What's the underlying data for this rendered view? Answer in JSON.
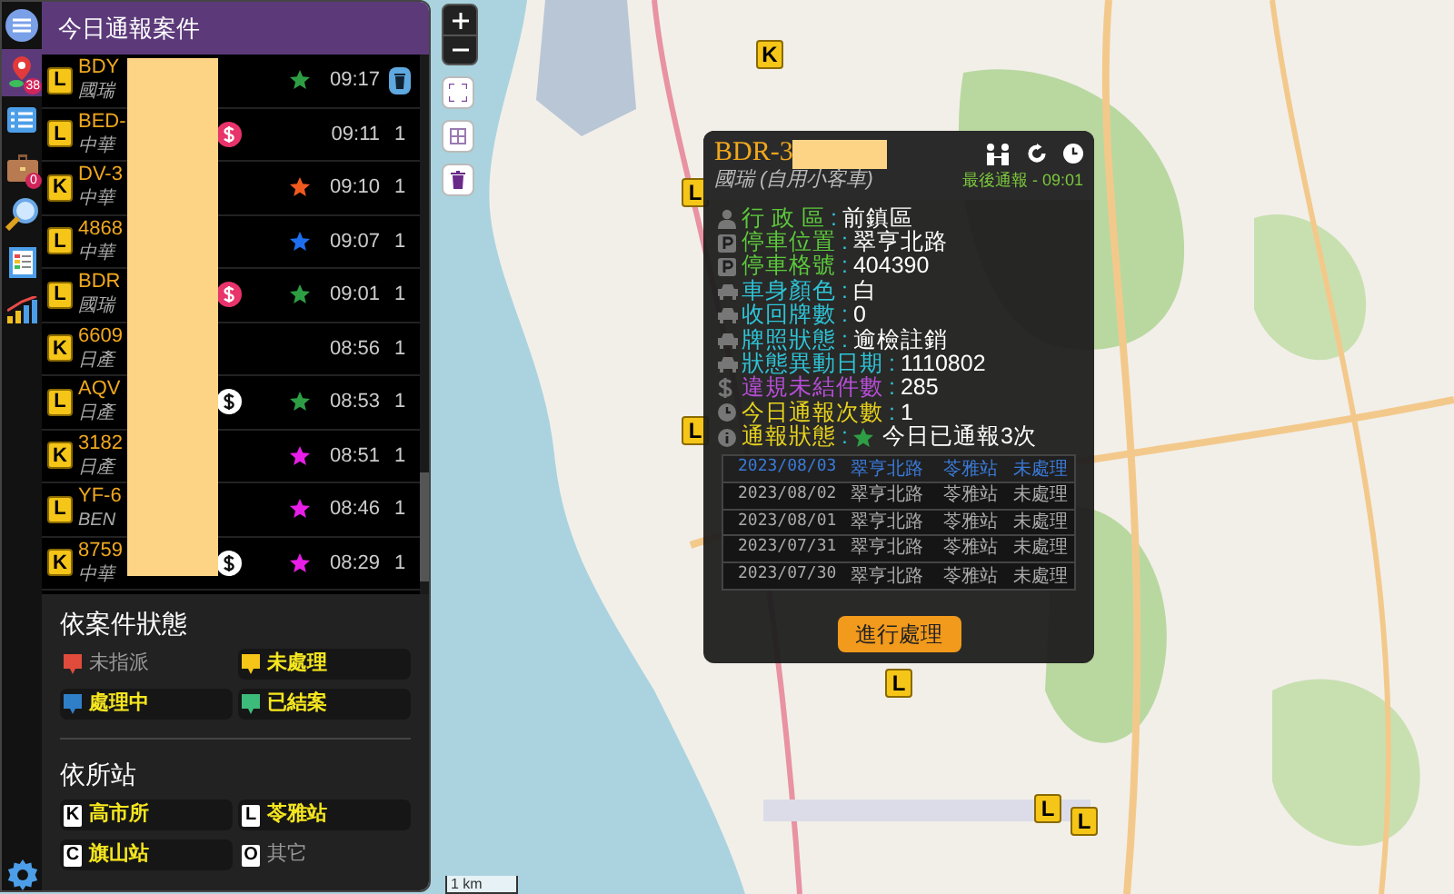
{
  "sidebar": {
    "title": "今日通報案件",
    "nav": [
      {
        "kind": "menu",
        "selected": false
      },
      {
        "kind": "pin",
        "selected": true,
        "badge": "38"
      },
      {
        "kind": "list",
        "selected": false
      },
      {
        "kind": "briefcase",
        "selected": false,
        "badge": "0"
      },
      {
        "kind": "search",
        "selected": false
      },
      {
        "kind": "report",
        "selected": false
      },
      {
        "kind": "chart",
        "selected": false
      }
    ],
    "cases": [
      {
        "station": "L",
        "plate": "BDY",
        "brand": "國瑞",
        "star": {
          "color": "#2e9e44"
        },
        "time": "09:17"
      },
      {
        "station": "L",
        "plate": "BED-",
        "brand": "中華",
        "dollar": {
          "color": "#e8336b"
        },
        "time": "09:11",
        "count": "1"
      },
      {
        "station": "K",
        "plate": "DV-3",
        "brand": "中華",
        "star": {
          "color": "#f05a1e"
        },
        "time": "09:10",
        "count": "1"
      },
      {
        "station": "L",
        "plate": "4868",
        "brand": "中華",
        "star": {
          "color": "#1e6ef0"
        },
        "time": "09:07",
        "count": "1"
      },
      {
        "station": "L",
        "plate": "BDR",
        "brand": "國瑞",
        "dollar": {
          "color": "#e8336b"
        },
        "star": {
          "color": "#2e9e44"
        },
        "time": "09:01",
        "count": "1"
      },
      {
        "station": "K",
        "plate": "6609",
        "brand": "日產",
        "time": "08:56",
        "count": "1"
      },
      {
        "station": "L",
        "plate": "AQV",
        "brand": "日產",
        "dollar": {
          "color": "#ffffff"
        },
        "star": {
          "color": "#2e9e44"
        },
        "time": "08:53",
        "count": "1"
      },
      {
        "station": "K",
        "plate": "3182",
        "brand": "日產",
        "star": {
          "color": "#e81ee8"
        },
        "time": "08:51",
        "count": "1"
      },
      {
        "station": "L",
        "plate": "YF-6",
        "brand": "BEN",
        "star": {
          "color": "#e81ee8"
        },
        "time": "08:46",
        "count": "1"
      },
      {
        "station": "K",
        "plate": "8759",
        "brand": "中華",
        "dollar": {
          "color": "#ffffff"
        },
        "star": {
          "color": "#e81ee8"
        },
        "time": "08:29",
        "count": "1"
      }
    ],
    "status_title": "依案件狀態",
    "statuses": [
      {
        "label": "未指派",
        "color": "#e04b3c",
        "selected": false
      },
      {
        "label": "未處理",
        "color": "#f5c518",
        "selected": true
      },
      {
        "label": "處理中",
        "color": "#2f7fc8",
        "selected": true
      },
      {
        "label": "已結案",
        "color": "#3dbb7a",
        "selected": true
      }
    ],
    "station_title": "依所站",
    "stations": [
      {
        "letter": "K",
        "label": "高市所",
        "selected": true
      },
      {
        "letter": "L",
        "label": "苓雅站",
        "selected": true
      },
      {
        "letter": "C",
        "label": "旗山站",
        "selected": true
      },
      {
        "letter": "O",
        "label": "其它",
        "selected": false
      }
    ]
  },
  "map": {
    "markers": [
      {
        "letter": "K"
      },
      {
        "letter": "L"
      },
      {
        "letter": "L"
      },
      {
        "letter": "L"
      },
      {
        "letter": "L"
      },
      {
        "letter": "L"
      }
    ],
    "scale": "1 km"
  },
  "popup": {
    "title": "BDR-3",
    "subtitle": "國瑞 (自用小客車)",
    "last_report": "最後通報 - 09:01",
    "fields": [
      {
        "kind": "person",
        "label": "行 政 區",
        "sep": ":",
        "color": "#5cc83c",
        "value": "前鎮區"
      },
      {
        "kind": "parking",
        "label": "停車位置",
        "sep": ":",
        "color": "#5cc83c",
        "value": "翠亨北路"
      },
      {
        "kind": "parking",
        "label": "停車格號",
        "sep": ":",
        "color": "#5cc83c",
        "value": "404390"
      },
      {
        "kind": "car",
        "label": "車身顏色",
        "sep": ":",
        "color": "#2ec4d6",
        "value": "白"
      },
      {
        "kind": "car",
        "label": "收回牌數",
        "sep": ":",
        "color": "#2ec4d6",
        "value": "0"
      },
      {
        "kind": "car",
        "label": "牌照狀態",
        "sep": ":",
        "color": "#2ec4d6",
        "value": "逾檢註銷"
      },
      {
        "kind": "car",
        "label": "狀態異動日期",
        "sep": ":",
        "color": "#2ec4d6",
        "value": "1110802"
      },
      {
        "kind": "dollar",
        "label": "違規未結件數",
        "sep": ":",
        "color": "#b84fd8",
        "value": "285"
      },
      {
        "kind": "clock",
        "label": "今日通報次數",
        "sep": ":",
        "color": "#e6d21e",
        "value": "1"
      },
      {
        "kind": "info",
        "label": "通報狀態",
        "sep": ":",
        "color": "#e6d21e",
        "value": "今日已通報3次",
        "star": {
          "color": "#2e9e44"
        }
      }
    ],
    "history": [
      {
        "date": "2023/08/03",
        "place": "翠亨北路",
        "station": "苓雅站",
        "status": "未處理",
        "selected": true
      },
      {
        "date": "2023/08/02",
        "place": "翠亨北路",
        "station": "苓雅站",
        "status": "未處理",
        "selected": false
      },
      {
        "date": "2023/08/01",
        "place": "翠亨北路",
        "station": "苓雅站",
        "status": "未處理",
        "selected": false
      },
      {
        "date": "2023/07/31",
        "place": "翠亨北路",
        "station": "苓雅站",
        "status": "未處理",
        "selected": false
      },
      {
        "date": "2023/07/30",
        "place": "翠亨北路",
        "station": "苓雅站",
        "status": "未處理",
        "selected": false
      }
    ],
    "button": "進行處理"
  }
}
